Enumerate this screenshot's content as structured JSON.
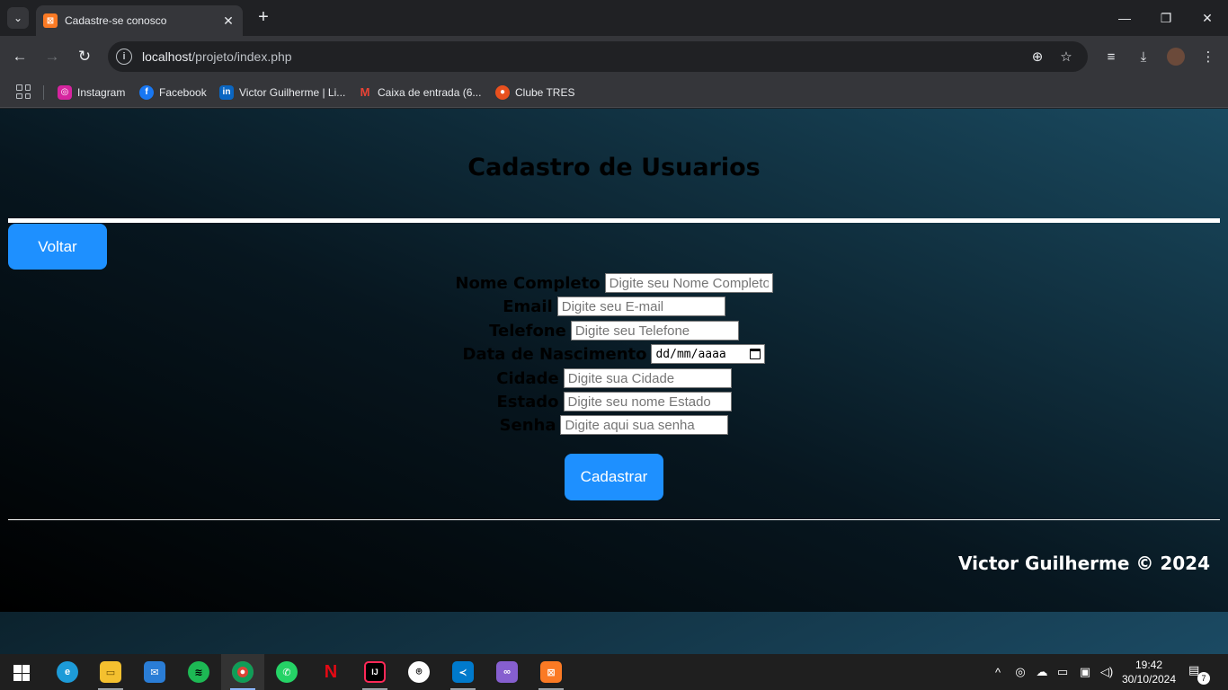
{
  "browser": {
    "tab_title": "Cadastre-se conosco",
    "tab_favicon": "xampp-icon",
    "url_host": "localhost",
    "url_path": "/projeto/index.php",
    "bookmarks": [
      {
        "label": "Instagram",
        "icon": "instagram-icon",
        "color": "#d6249f"
      },
      {
        "label": "Facebook",
        "icon": "facebook-icon",
        "color": "#1877f2"
      },
      {
        "label": "Victor Guilherme | Li...",
        "icon": "linkedin-icon",
        "color": "#0a66c2"
      },
      {
        "label": "Caixa de entrada (6...",
        "icon": "gmail-icon",
        "color": "#ea4335"
      },
      {
        "label": "Clube TRES",
        "icon": "clube-tres-icon",
        "color": "#e8501e"
      }
    ]
  },
  "page": {
    "title": "Cadastro de Usuarios",
    "back_button": "Voltar",
    "form": {
      "fields": [
        {
          "label": "Nome Completo",
          "placeholder": "Digite seu Nome Completo"
        },
        {
          "label": "Email",
          "placeholder": "Digite seu E-mail"
        },
        {
          "label": "Telefone",
          "placeholder": "Digite seu Telefone"
        },
        {
          "label": "Data de Nascimento",
          "date_format": "dd/mm/aaaa"
        },
        {
          "label": "Cidade",
          "placeholder": "Digite sua Cidade"
        },
        {
          "label": "Estado",
          "placeholder": "Digite seu nome Estado"
        },
        {
          "label": "Senha",
          "placeholder": "Digite aqui sua senha"
        }
      ],
      "submit_label": "Cadastrar"
    },
    "footer": "Victor Guilherme © 2024"
  },
  "taskbar": {
    "apps": [
      "edge-icon",
      "file-explorer-icon",
      "mail-icon",
      "spotify-icon",
      "chrome-icon",
      "whatsapp-icon",
      "netflix-icon",
      "intellij-icon",
      "github-icon",
      "vscode-icon",
      "visual-studio-icon",
      "xampp-icon"
    ],
    "time": "19:42",
    "date": "30/10/2024",
    "notification_count": "7"
  }
}
